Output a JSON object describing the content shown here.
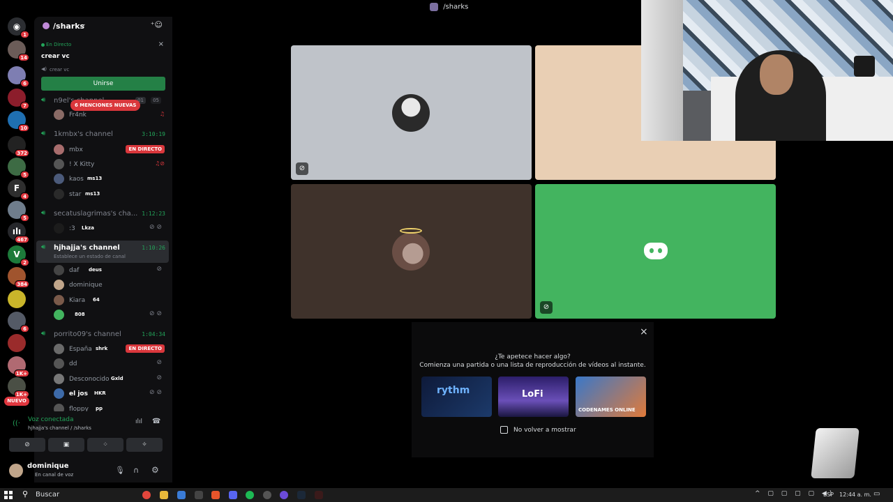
{
  "window": {
    "title": "/sharks"
  },
  "rail": {
    "badges": [
      "1",
      "14",
      "6",
      "7",
      "10",
      "372",
      "5",
      "4",
      "5",
      "467",
      "2",
      "384",
      "6",
      "1K+",
      "1K+"
    ],
    "new_label": "NUEVO"
  },
  "server": {
    "name": "/sharks",
    "event": {
      "status": "En Directo",
      "title": "crear vc",
      "sub": "crear vc",
      "join_label": "Unirse"
    },
    "mentions_label": "6 MENCIONES NUEVAS",
    "channels": [
      {
        "name": "n9el's channel",
        "counter": "01",
        "counter2": "05",
        "users": [
          {
            "name": "Fr4nk"
          }
        ]
      },
      {
        "name": "1kmbx's channel",
        "time": "3:10:19",
        "users": [
          {
            "name": "mbx",
            "live": "EN DIRECTO"
          },
          {
            "name": "! X Kitty"
          },
          {
            "name": "kaos",
            "tag": "ms13"
          },
          {
            "name": "star",
            "tag": "ms13"
          }
        ]
      },
      {
        "name": "secatuslagrimas's cha...",
        "time": "1:12:23",
        "users": [
          {
            "name": ":3",
            "tag": "Lkza"
          }
        ]
      },
      {
        "name": "hjhajja's channel",
        "time": "1:10:26",
        "status": "Establece un estado de canal",
        "users": [
          {
            "name": "daf",
            "tag": "deus"
          },
          {
            "name": "dominique"
          },
          {
            "name": "Kiara",
            "tag": "64"
          },
          {
            "name": "",
            "tag": "808"
          }
        ]
      },
      {
        "name": "porrito09's channel",
        "time": "1:04:34",
        "users": [
          {
            "name": "España",
            "tag": "shrk",
            "live": "EN DIRECTO"
          },
          {
            "name": "dd"
          },
          {
            "name": "Desconocido",
            "tag": "Gxld"
          },
          {
            "name": "el jos",
            "tag": "HKR"
          },
          {
            "name": "floppy",
            "tag": "pp"
          }
        ]
      }
    ]
  },
  "voice": {
    "status": "Voz conectada",
    "location": "hjhajja's channel / /sharks"
  },
  "me": {
    "name": "dominique",
    "status": "En canal de voz"
  },
  "popup": {
    "title": "¿Te apetece hacer algo?",
    "subtitle": "Comienza una partida o una lista de reproducción de vídeos al instante.",
    "activities": [
      "rythm",
      "LoFi",
      "CODENAMES ONLINE"
    ],
    "checkbox_label": "No volver a mostrar"
  },
  "taskbar": {
    "search": "Buscar",
    "lang": "ESP",
    "clock": "12:44 a. m."
  },
  "colors": {
    "green": "#23a55a",
    "join": "#248046",
    "live": "#da373c",
    "tile_gray": "#bfc3c9",
    "tile_beige": "#e9cfb4",
    "tile_brown": "#3f322b",
    "tile_green": "#43b45f"
  }
}
